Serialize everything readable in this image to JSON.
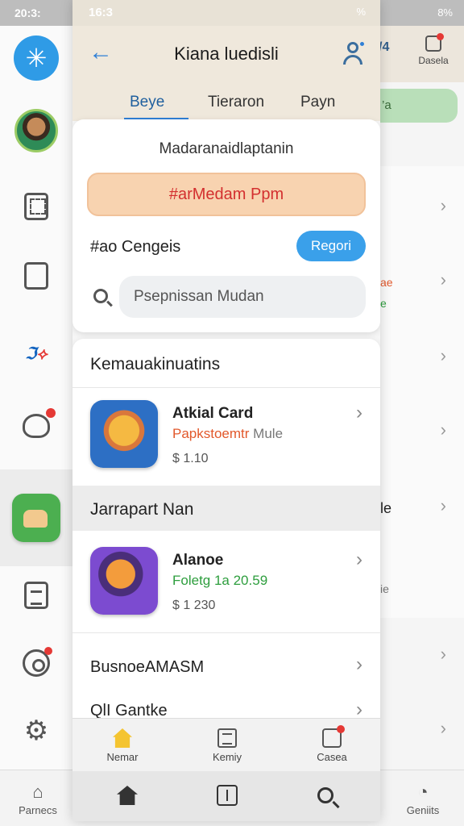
{
  "background": {
    "status_time": "20:3:",
    "status_right": "8%",
    "top_right_number": "/​4",
    "top_button_label": "Dasela",
    "green_chip_text": "’a",
    "right_fragments": [
      "ae",
      "e",
      "le",
      "ie"
    ],
    "bottom_left_label": "Parnecs",
    "bottom_right_label": "Geniits"
  },
  "sheet": {
    "status_time": "16:3",
    "status_right": "%",
    "title": "Kiana luedisli",
    "tabs": [
      "Beye",
      "Tieraron",
      "Payn"
    ],
    "card": {
      "title": "Madaranaidlaptanin",
      "banner": "#arMedam Ppm",
      "label": "#ao Cengeis",
      "button": "Regori",
      "search_placeholder": "Psepnissan Mudan"
    },
    "section1_title": "Kemauakinuatins",
    "app1": {
      "name": "Atkial Card",
      "sub_main": "Papkstoemtr",
      "sub_extra": "Mule",
      "price": "$ 1.10"
    },
    "section2_title": "Jarrapart Nan",
    "app2": {
      "name": "Alanoe",
      "sub_main": "Foletg 1a 20.59",
      "price": "$ 1 230"
    },
    "row3": "BusnoeAMASM",
    "row4": "QlI Gantke",
    "nav1": [
      "Nemar",
      "Kemiy",
      "Casea"
    ]
  }
}
